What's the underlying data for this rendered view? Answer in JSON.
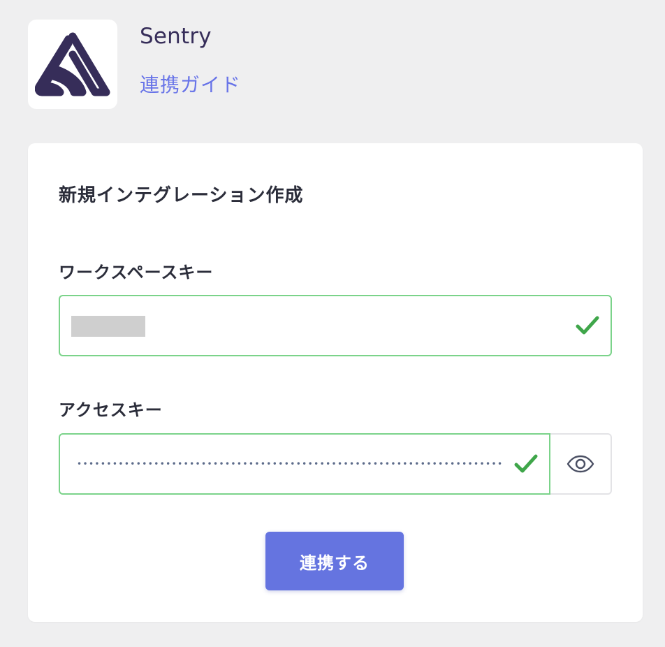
{
  "app": {
    "name": "Sentry",
    "guide_link_label": "連携ガイド",
    "logo_icon": "sentry-logo-icon"
  },
  "form": {
    "title": "新規インテグレーション作成",
    "workspace_key": {
      "label": "ワークスペースキー",
      "value_redacted": true,
      "status_icon": "check-icon",
      "status": "valid"
    },
    "access_key": {
      "label": "アクセスキー",
      "masked_value": "•••••••••••••••••••••••••••••••••••••••••••••••••••••••••••••••••••••••••••••••••••••••••",
      "status_icon": "check-icon",
      "status": "valid",
      "toggle_visibility_icon": "eye-icon"
    },
    "submit_label": "連携する"
  },
  "colors": {
    "background": "#efeff0",
    "card": "#ffffff",
    "brand_logo": "#362d59",
    "link": "#6874e8",
    "valid_border": "#7bd38a",
    "valid_check": "#3fa64a",
    "primary_button": "#6574e0"
  }
}
